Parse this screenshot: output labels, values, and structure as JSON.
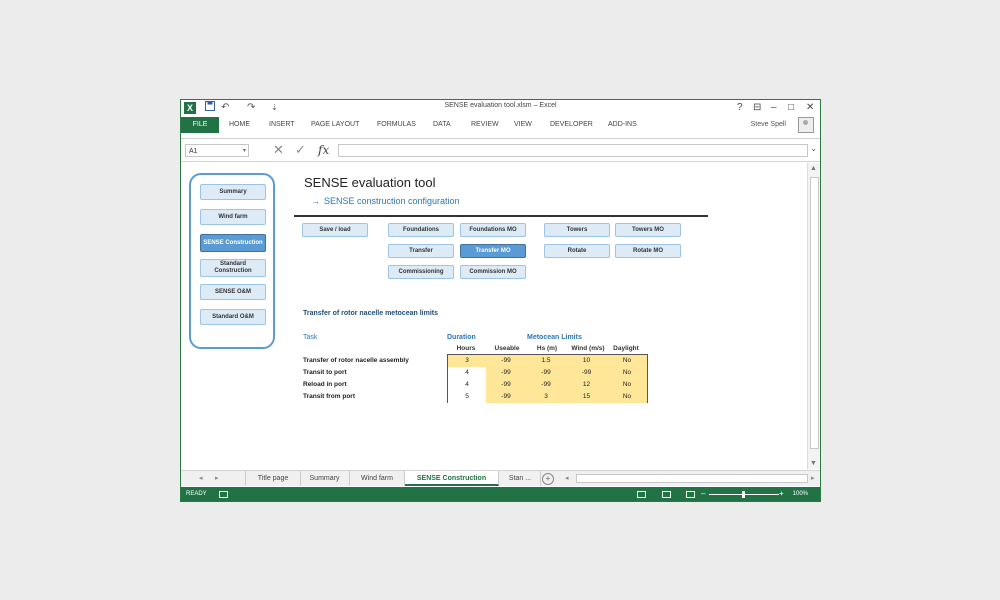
{
  "window": {
    "title": "SENSE evaluation tool.xlsm – Excel",
    "logo": "X",
    "user": "Steve Spell",
    "help": "?",
    "buttons": {
      "restore_ribbon": "⊟",
      "minimize": "–",
      "maximize": "□",
      "close": "✕"
    }
  },
  "quick_access": {
    "save_icon": "save-icon",
    "undo": "↶",
    "redo": "↷",
    "customize": "⇣"
  },
  "ribbon": {
    "file": "FILE",
    "tabs": [
      "HOME",
      "INSERT",
      "PAGE LAYOUT",
      "FORMULAS",
      "DATA",
      "REVIEW",
      "VIEW",
      "DEVELOPER",
      "ADD-INS"
    ]
  },
  "formula_bar": {
    "name_box": "A1",
    "name_dd": "▾",
    "cancel": "✕",
    "enter": "✓",
    "fx": "fx",
    "value": "",
    "expand": "⌄"
  },
  "nav": {
    "summary": "Summary",
    "wind_farm": "Wind farm",
    "sense_construction": "SENSE Construction",
    "standard_construction": "Standard Construction",
    "sense_om": "SENSE O&M",
    "standard_om": "Standard O&M"
  },
  "heading": {
    "title": "SENSE evaluation tool",
    "arrow": "→",
    "subtitle": "SENSE construction configuration"
  },
  "buttons": {
    "save_load": "Save / load",
    "foundations": "Foundations",
    "foundations_mo": "Foundations MO",
    "towers": "Towers",
    "towers_mo": "Towers MO",
    "transfer": "Transfer",
    "transfer_mo": "Transfer MO",
    "rotate": "Rotate",
    "rotate_mo": "Rotate MO",
    "commissioning": "Commissioning",
    "commission_mo": "Commission MO"
  },
  "section": {
    "title": "Transfer of rotor nacelle metocean limits",
    "task_header": "Task",
    "duration_header": "Duration",
    "metocean_header": "Metocean Limits",
    "columns": [
      "Hours",
      "Useable",
      "Hs (m)",
      "Wind (m/s)",
      "Daylight"
    ]
  },
  "rows": [
    {
      "task": "Transfer of rotor nacelle assembly",
      "hours": "3",
      "useable": "-99",
      "hs": "1.5",
      "wind": "10",
      "daylight": "No"
    },
    {
      "task": "Transit to port",
      "hours": "4",
      "useable": "-99",
      "hs": "-99",
      "wind": "-99",
      "daylight": "No"
    },
    {
      "task": "Reload in port",
      "hours": "4",
      "useable": "-99",
      "hs": "-99",
      "wind": "12",
      "daylight": "No"
    },
    {
      "task": "Transit from port",
      "hours": "5",
      "useable": "-99",
      "hs": "3",
      "wind": "15",
      "daylight": "No"
    }
  ],
  "sheet_tabs": {
    "prev": "◂",
    "next": "▸",
    "tabs": [
      "Title page",
      "Summary",
      "Wind farm",
      "SENSE Construction",
      "Stan ..."
    ],
    "add": "+"
  },
  "scroll": {
    "up": "▲",
    "down": "▼",
    "left": "◂",
    "right": "▸"
  },
  "status": {
    "ready": "READY",
    "zoom": "100%",
    "zoom_out": "–",
    "zoom_in": "+"
  },
  "colors": {
    "excel_green": "#217346",
    "button_fill": "#ddebf7",
    "button_active": "#5b9bd5",
    "input_cell": "#fce4d6",
    "calc_cell": "#ffe699"
  }
}
